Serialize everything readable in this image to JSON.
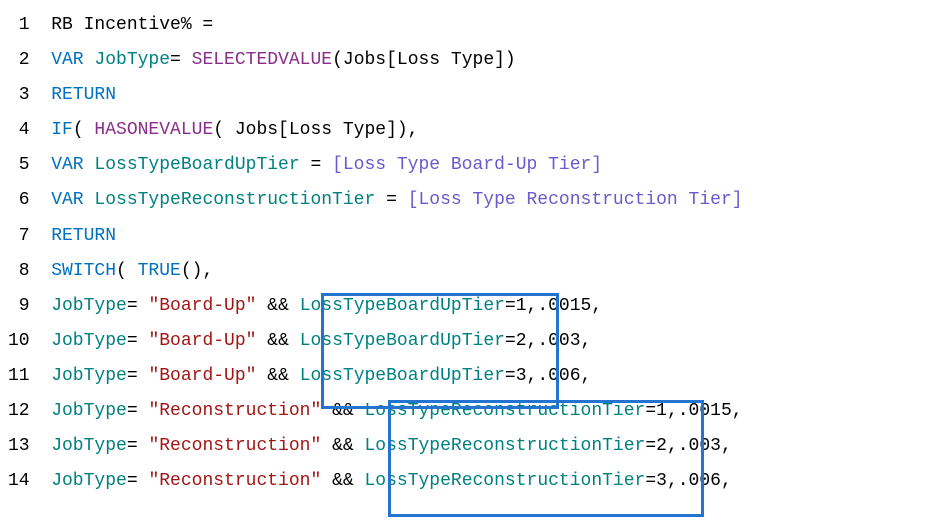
{
  "lines": [
    {
      "num": "1",
      "tokens": [
        {
          "t": " ",
          "c": "black"
        },
        {
          "t": "RB Incentive% =",
          "c": "black"
        }
      ]
    },
    {
      "num": "2",
      "tokens": [
        {
          "t": " ",
          "c": "black"
        },
        {
          "t": "VAR",
          "c": "kw"
        },
        {
          "t": " ",
          "c": "black"
        },
        {
          "t": "JobType",
          "c": "id"
        },
        {
          "t": "= ",
          "c": "black"
        },
        {
          "t": "SELECTEDVALUE",
          "c": "fn"
        },
        {
          "t": "(Jobs[Loss Type])",
          "c": "black"
        }
      ]
    },
    {
      "num": "3",
      "tokens": [
        {
          "t": " ",
          "c": "black"
        },
        {
          "t": "RETURN",
          "c": "kw"
        }
      ]
    },
    {
      "num": "4",
      "tokens": [
        {
          "t": " ",
          "c": "black"
        },
        {
          "t": "IF",
          "c": "kw"
        },
        {
          "t": "( ",
          "c": "black"
        },
        {
          "t": "HASONEVALUE",
          "c": "fn"
        },
        {
          "t": "( Jobs[Loss Type]),",
          "c": "black"
        }
      ]
    },
    {
      "num": "5",
      "tokens": [
        {
          "t": " ",
          "c": "black"
        },
        {
          "t": "VAR",
          "c": "kw"
        },
        {
          "t": " ",
          "c": "black"
        },
        {
          "t": "LossTypeBoardUpTier",
          "c": "id"
        },
        {
          "t": " = ",
          "c": "black"
        },
        {
          "t": "[Loss Type Board-Up Tier]",
          "c": "meas"
        }
      ]
    },
    {
      "num": "6",
      "tokens": [
        {
          "t": " ",
          "c": "black"
        },
        {
          "t": "VAR",
          "c": "kw"
        },
        {
          "t": " ",
          "c": "black"
        },
        {
          "t": "LossTypeReconstructionTier",
          "c": "id"
        },
        {
          "t": " = ",
          "c": "black"
        },
        {
          "t": "[Loss Type Reconstruction Tier]",
          "c": "meas"
        }
      ]
    },
    {
      "num": "7",
      "tokens": [
        {
          "t": " ",
          "c": "black"
        },
        {
          "t": "RETURN",
          "c": "kw"
        }
      ]
    },
    {
      "num": "8",
      "tokens": [
        {
          "t": " ",
          "c": "black"
        },
        {
          "t": "SWITCH",
          "c": "kw"
        },
        {
          "t": "( ",
          "c": "black"
        },
        {
          "t": "TRUE",
          "c": "kw"
        },
        {
          "t": "(),",
          "c": "black"
        }
      ]
    },
    {
      "num": "9",
      "tokens": [
        {
          "t": " ",
          "c": "black"
        },
        {
          "t": "JobType",
          "c": "id"
        },
        {
          "t": "= ",
          "c": "black"
        },
        {
          "t": "\"Board-Up\"",
          "c": "str"
        },
        {
          "t": " && ",
          "c": "black"
        },
        {
          "t": "LossTypeBoardUpTier",
          "c": "id"
        },
        {
          "t": "=1,.0015,",
          "c": "black"
        }
      ]
    },
    {
      "num": "10",
      "tokens": [
        {
          "t": " ",
          "c": "black"
        },
        {
          "t": "JobType",
          "c": "id"
        },
        {
          "t": "= ",
          "c": "black"
        },
        {
          "t": "\"Board-Up\"",
          "c": "str"
        },
        {
          "t": " && ",
          "c": "black"
        },
        {
          "t": "LossTypeBoardUpTier",
          "c": "id"
        },
        {
          "t": "=2,.003,",
          "c": "black"
        }
      ]
    },
    {
      "num": "11",
      "tokens": [
        {
          "t": " ",
          "c": "black"
        },
        {
          "t": "JobType",
          "c": "id"
        },
        {
          "t": "= ",
          "c": "black"
        },
        {
          "t": "\"Board-Up\"",
          "c": "str"
        },
        {
          "t": " && ",
          "c": "black"
        },
        {
          "t": "LossTypeBoardUpTier",
          "c": "id"
        },
        {
          "t": "=3,.006,",
          "c": "black"
        }
      ]
    },
    {
      "num": "12",
      "tokens": [
        {
          "t": " ",
          "c": "black"
        },
        {
          "t": "JobType",
          "c": "id"
        },
        {
          "t": "= ",
          "c": "black"
        },
        {
          "t": "\"Reconstruction\"",
          "c": "str"
        },
        {
          "t": " && ",
          "c": "black"
        },
        {
          "t": "LossTypeReconstructionTier",
          "c": "id"
        },
        {
          "t": "=1,.0015,",
          "c": "black"
        }
      ]
    },
    {
      "num": "13",
      "tokens": [
        {
          "t": " ",
          "c": "black"
        },
        {
          "t": "JobType",
          "c": "id"
        },
        {
          "t": "= ",
          "c": "black"
        },
        {
          "t": "\"Reconstruction\"",
          "c": "str"
        },
        {
          "t": " && ",
          "c": "black"
        },
        {
          "t": "LossTypeReconstructionTier",
          "c": "id"
        },
        {
          "t": "=2,.003,",
          "c": "black"
        }
      ]
    },
    {
      "num": "14",
      "tokens": [
        {
          "t": " ",
          "c": "black"
        },
        {
          "t": "JobType",
          "c": "id"
        },
        {
          "t": "= ",
          "c": "black"
        },
        {
          "t": "\"Reconstruction\"",
          "c": "str"
        },
        {
          "t": " && ",
          "c": "black"
        },
        {
          "t": "LossTypeReconstructionTier",
          "c": "id"
        },
        {
          "t": "=3,.006,",
          "c": "black"
        }
      ]
    }
  ]
}
